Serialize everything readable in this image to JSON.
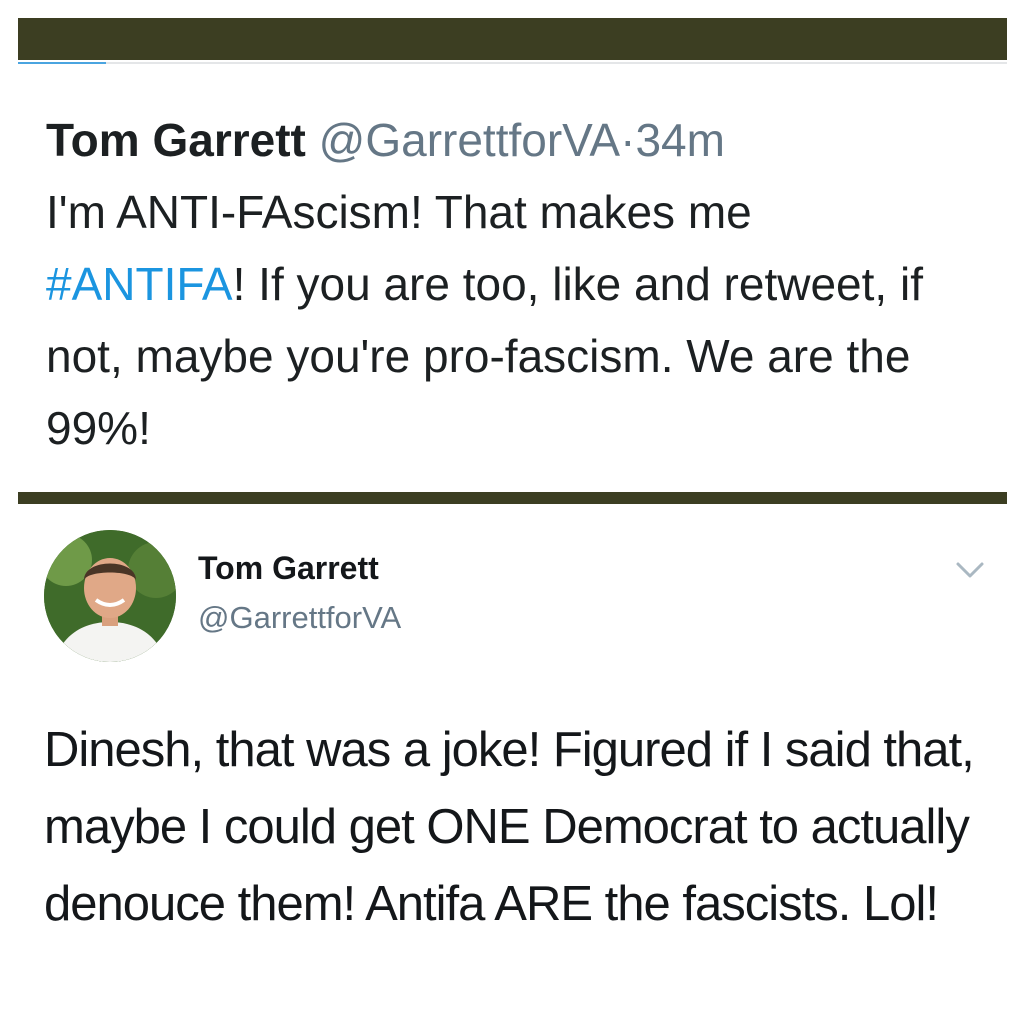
{
  "colors": {
    "bar": "#3c3e22",
    "accent": "#4aa4e0",
    "hashtag": "#1b95e0",
    "muted": "#657786",
    "text": "#14171a"
  },
  "quoted_tweet": {
    "author_name": "Tom Garrett",
    "handle": "@GarrettforVA",
    "separator": "·",
    "time": "34m",
    "text_part1": "I'm ANTI-FAscism!  That makes me",
    "hashtag": "#ANTIFA",
    "text_part2": "!  If you are too, like and retweet, if not, maybe you're pro-fascism.  We are the 99%!"
  },
  "tweet": {
    "author_name": "Tom Garrett",
    "handle": "@GarrettforVA",
    "menu_icon": "chevron-down-icon",
    "avatar_icon": "avatar",
    "text": "Dinesh, that was a joke! Figured if I said that, maybe I could get ONE Democrat to actually denouce them!  Antifa ARE the fascists.  Lol!"
  }
}
